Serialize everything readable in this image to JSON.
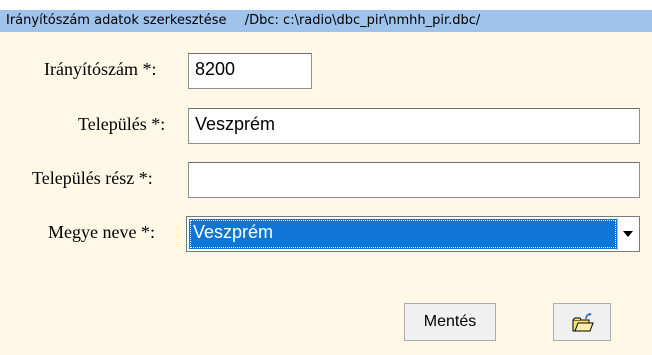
{
  "window": {
    "title": "Irányítószám adatok szerkesztése",
    "dbc_path": "/Dbc: c:\\radio\\dbc_pir\\nmhh_pir.dbc/"
  },
  "form": {
    "zip_label": "Irányítószám *:",
    "zip_value": "8200",
    "settlement_label": "Település *:",
    "settlement_value": "Veszprém",
    "settlement_part_label": "Település rész *:",
    "settlement_part_value": "",
    "county_label": "Megye neve *:",
    "county_value": "Veszprém"
  },
  "buttons": {
    "save_label": "Mentés",
    "open_icon": "folder-open-icon"
  },
  "colors": {
    "titlebar": "#9fc3eb",
    "dialog_bg": "#fff8e7",
    "selection": "#0f76d6"
  }
}
